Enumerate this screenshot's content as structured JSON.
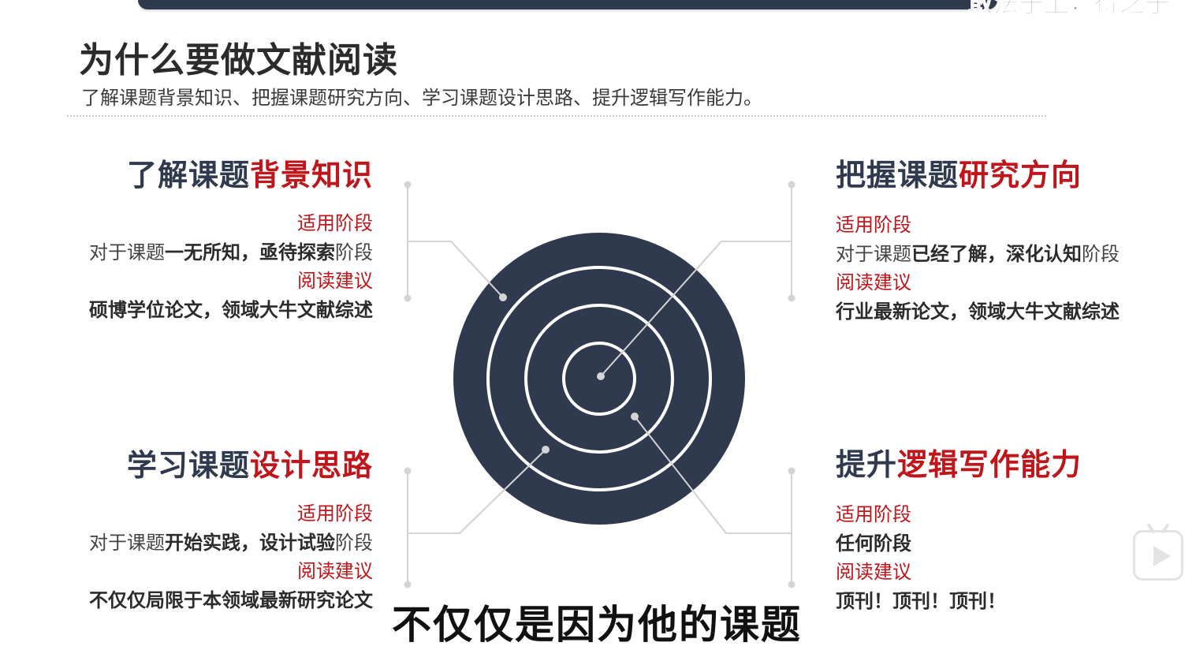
{
  "overlay": {
    "top_right_text": "敢法于上，得之于"
  },
  "header": {
    "title": "为什么要做文献阅读",
    "subtitle": "了解课题背景知识、把握课题研究方向、学习课题设计思路、提升逻辑写作能力。"
  },
  "quadrants": {
    "top_left": {
      "title_plain": "了解课题",
      "title_highlight": "背景知识",
      "stage_label": "适用阶段",
      "stage_prefix": "对于课题",
      "stage_bold_a": "一无所知",
      "stage_sep": "，",
      "stage_bold_b": "亟待探索",
      "stage_suffix": "阶段",
      "advice_label": "阅读建议",
      "advice": "硕博学位论文，领域大牛文献综述"
    },
    "top_right": {
      "title_plain": "把握课题",
      "title_highlight": "研究方向",
      "stage_label": "适用阶段",
      "stage_prefix": "对于课题",
      "stage_bold_a": "已经了解",
      "stage_sep": "，",
      "stage_bold_b": "深化认知",
      "stage_suffix": "阶段",
      "advice_label": "阅读建议",
      "advice": "行业最新论文，领域大牛文献综述"
    },
    "bottom_left": {
      "title_plain": "学习课题",
      "title_highlight": "设计思路",
      "stage_label": "适用阶段",
      "stage_prefix": "对于课题",
      "stage_bold_a": "开始实践",
      "stage_sep": "，",
      "stage_bold_b": "设计试验",
      "stage_suffix": "阶段",
      "advice_label": "阅读建议",
      "advice": "不仅仅局限于本领域最新研究论文"
    },
    "bottom_right": {
      "title_plain": "提升",
      "title_highlight": "逻辑写作能力",
      "stage_label": "适用阶段",
      "stage_text": "任何阶段",
      "advice_label": "阅读建议",
      "advice": "顶刊！顶刊！顶刊！"
    }
  },
  "subtitle_caption": "不仅仅是因为他的课题",
  "colors": {
    "navy": "#2f3a4e",
    "accent_red": "#c0161b",
    "text_dark": "#2b2b2b",
    "connector_gray": "#d4d4d4"
  },
  "icons": {
    "player_button": "tv-play-icon"
  }
}
